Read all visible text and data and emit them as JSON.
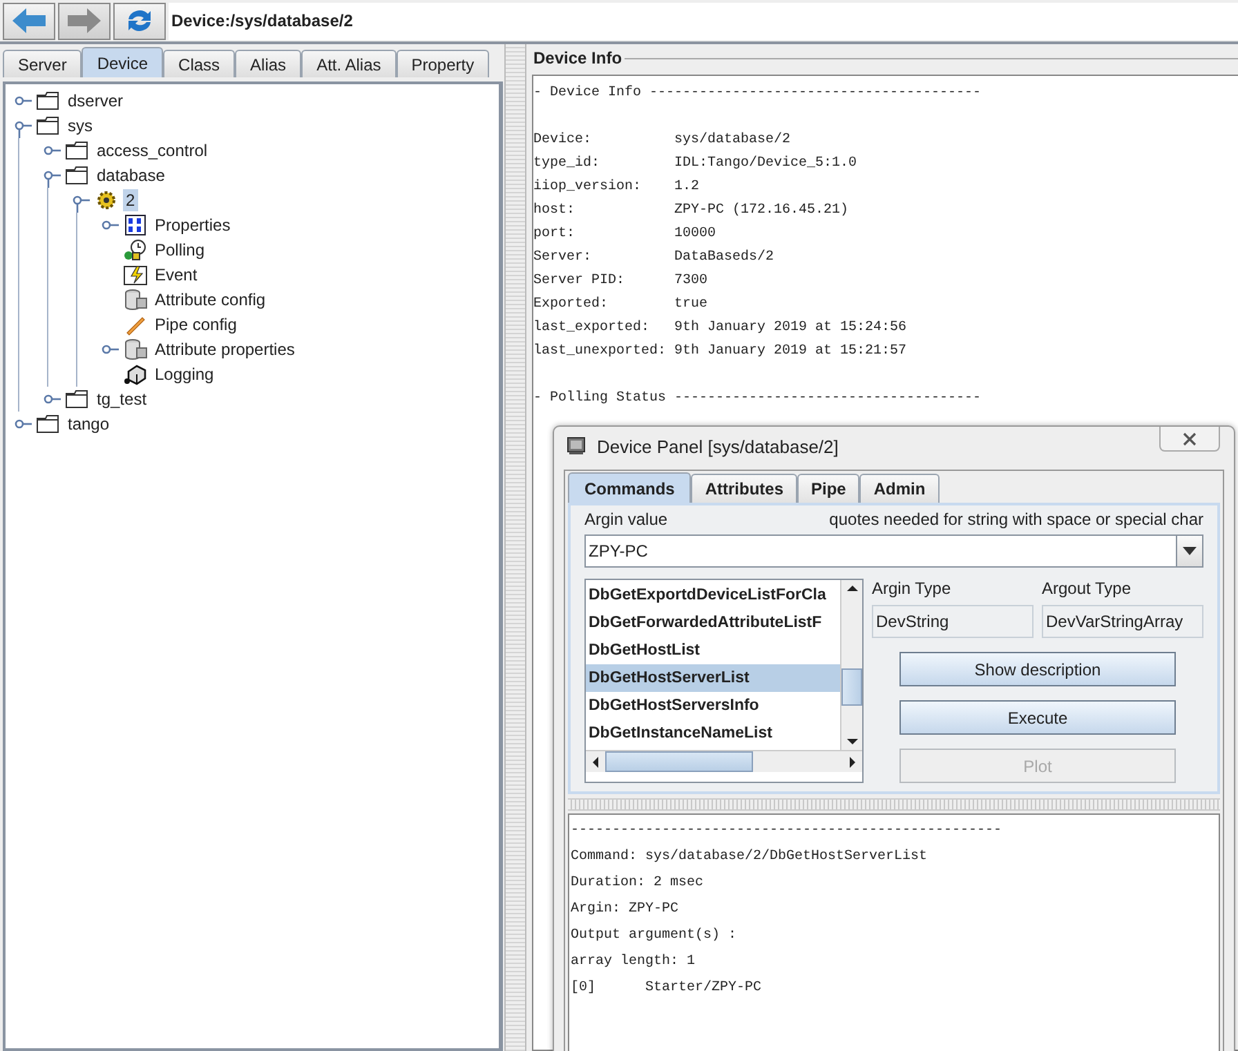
{
  "toolbar": {
    "buttons": [
      {
        "kind": "back",
        "disabled": false
      },
      {
        "kind": "forward",
        "disabled": true
      },
      {
        "kind": "refresh",
        "disabled": false
      }
    ],
    "path": "Device:/sys/database/2"
  },
  "left_tabs": [
    {
      "label": "Server",
      "selected": false
    },
    {
      "label": "Device",
      "selected": true
    },
    {
      "label": "Class",
      "selected": false
    },
    {
      "label": "Alias",
      "selected": false
    },
    {
      "label": "Att. Alias",
      "selected": false
    },
    {
      "label": "Property",
      "selected": false
    }
  ],
  "tree": [
    {
      "label": "dserver",
      "kind": "folder",
      "expanded": false,
      "selected": false
    },
    {
      "label": "sys",
      "kind": "folder",
      "expanded": true,
      "selected": false,
      "children": [
        {
          "label": "access_control",
          "kind": "folder",
          "expanded": false,
          "selected": false
        },
        {
          "label": "database",
          "kind": "folder",
          "expanded": true,
          "selected": false,
          "children": [
            {
              "label": "2",
              "kind": "device",
              "expanded": true,
              "selected": true,
              "children": [
                {
                  "label": "Properties",
                  "kind": "properties",
                  "expanded": false,
                  "selected": false
                },
                {
                  "label": "Polling",
                  "kind": "polling",
                  "selected": false
                },
                {
                  "label": "Event",
                  "kind": "event",
                  "selected": false
                },
                {
                  "label": "Attribute config",
                  "kind": "attributes",
                  "selected": false
                },
                {
                  "label": "Pipe config",
                  "kind": "pipe",
                  "selected": false
                },
                {
                  "label": "Attribute properties",
                  "kind": "attributes",
                  "expanded": false,
                  "selected": false
                },
                {
                  "label": "Logging",
                  "kind": "logging",
                  "selected": false
                }
              ]
            }
          ]
        },
        {
          "label": "tg_test",
          "kind": "folder",
          "expanded": false,
          "selected": false
        }
      ]
    },
    {
      "label": "tango",
      "kind": "folder",
      "expanded": false,
      "selected": false
    }
  ],
  "device_info": {
    "title": "Device Info",
    "header": "- Device Info ----------------------------------------",
    "fields": [
      {
        "label": "Device:",
        "value": "sys/database/2"
      },
      {
        "label": "type_id:",
        "value": "IDL:Tango/Device_5:1.0"
      },
      {
        "label": "iiop_version:",
        "value": "1.2"
      },
      {
        "label": "host:",
        "value": "ZPY-PC (172.16.45.21)"
      },
      {
        "label": "port:",
        "value": "10000"
      },
      {
        "label": "Server:",
        "value": "DataBaseds/2"
      },
      {
        "label": "Server PID:",
        "value": "7300"
      },
      {
        "label": "Exported:",
        "value": "true"
      },
      {
        "label": "last_exported:",
        "value": "9th January 2019 at 15:24:56"
      },
      {
        "label": "last_unexported:",
        "value": "9th January 2019 at 15:21:57"
      }
    ],
    "footer": "- Polling Status -------------------------------------"
  },
  "device_panel": {
    "title": "Device Panel [sys/database/2]",
    "tabs": [
      {
        "label": "Commands",
        "selected": true
      },
      {
        "label": "Attributes",
        "selected": false
      },
      {
        "label": "Pipe",
        "selected": false
      },
      {
        "label": "Admin",
        "selected": false
      }
    ],
    "argin_label": "Argin value",
    "hint": "quotes needed for string with space or special char",
    "argin_value": "ZPY-PC",
    "commands": [
      {
        "label": "DbGetExportdDeviceListForCla",
        "selected": false
      },
      {
        "label": "DbGetForwardedAttributeListF",
        "selected": false
      },
      {
        "label": "DbGetHostList",
        "selected": false
      },
      {
        "label": "DbGetHostServerList",
        "selected": true
      },
      {
        "label": "DbGetHostServersInfo",
        "selected": false
      },
      {
        "label": "DbGetInstanceNameList",
        "selected": false
      }
    ],
    "argin_type_label": "Argin Type",
    "argout_type_label": "Argout Type",
    "argin_type": "DevString",
    "argout_type": "DevVarStringArray",
    "buttons": [
      {
        "label": "Show description",
        "disabled": false
      },
      {
        "label": "Execute",
        "disabled": false
      },
      {
        "label": "Plot",
        "disabled": true
      }
    ],
    "output": [
      "----------------------------------------------------",
      "Command: sys/database/2/DbGetHostServerList",
      "Duration: 2 msec",
      "Argin: ZPY-PC",
      "Output argument(s) :",
      "array length: 1",
      "[0]      Starter/ZPY-PC"
    ]
  }
}
